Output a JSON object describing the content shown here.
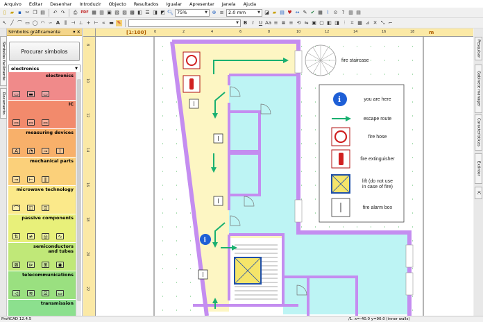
{
  "menu": [
    "Arquivo",
    "Editar",
    "Desenhar",
    "Introduzir",
    "Objecto",
    "Resultados",
    "Igualar",
    "Apresentar",
    "Janela",
    "Ajuda"
  ],
  "toolbar": {
    "zoom": "75%",
    "line_width": "2.0 mm",
    "pdf_label": "PDF"
  },
  "panel": {
    "title": "Símbolos gráficamente",
    "search_button": "Procurar símbolos",
    "library": "electronics",
    "categories": [
      {
        "name": "electronics",
        "color": "#f08a8a",
        "icons": [
          "▭",
          "▬",
          "▭"
        ]
      },
      {
        "name": "IC",
        "color": "#f28a6c",
        "icons": [
          "▭",
          "▭",
          "▭"
        ]
      },
      {
        "name": "measuring devices",
        "color": "#f8b06a",
        "icons": [
          "A",
          "◔",
          "⊸",
          "⌇"
        ]
      },
      {
        "name": "mechanical parts",
        "color": "#fbd07a",
        "icons": [
          "⊸",
          "⊢",
          "‖"
        ]
      },
      {
        "name": "microwave technology",
        "color": "#fbe98a",
        "icons": [
          "⌒",
          "◫",
          "⊡"
        ]
      },
      {
        "name": "passive components",
        "color": "#e8f07a",
        "icons": [
          "⇅",
          "≠",
          "◎",
          "∿"
        ]
      },
      {
        "name": "semiconductors and tubes",
        "color": "#c0e878",
        "icons": [
          "⊠",
          "⊳",
          "⊞",
          "◉"
        ]
      },
      {
        "name": "telecommunications",
        "color": "#9ae080",
        "icons": [
          "◁",
          "≋",
          "⊡",
          "▭"
        ]
      },
      {
        "name": "transmission",
        "color": "#8ce08e",
        "icons": []
      }
    ]
  },
  "left_tabs": [
    "Símbolos facilmente",
    "Documento"
  ],
  "right_tabs": [
    "Pesquisar",
    "Gabinete manager",
    "Características",
    "Extintor",
    "IC"
  ],
  "ruler": {
    "scale_label": "[1:100]",
    "unit": "m",
    "h_ticks": [
      "0",
      "2",
      "4",
      "6",
      "8",
      "10",
      "12",
      "14",
      "16",
      "18"
    ],
    "v_ticks": [
      "8",
      "10",
      "12",
      "14",
      "16",
      "18",
      "20",
      "22"
    ]
  },
  "plan": {
    "fire_staircase": "fire staircase",
    "legend": [
      {
        "symbol": "info",
        "label": "you are here"
      },
      {
        "symbol": "arrow",
        "label": "escape route"
      },
      {
        "symbol": "hose",
        "label": "fire hose"
      },
      {
        "symbol": "extinguisher",
        "label": "fire extinguisher"
      },
      {
        "symbol": "lift",
        "label": "lift (do not use in case of fire)"
      },
      {
        "symbol": "alarm",
        "label": "fire alarm box"
      }
    ]
  },
  "colors": {
    "wall": "#c48df0",
    "corridor": "#fdf6c3",
    "room": "#bdf4f4",
    "arrow": "#19b070",
    "info": "#1e5fd6"
  },
  "status": {
    "app": "ProfiCAD 12.4.5",
    "coords": "/1. x=-40.0  y=90.0 (inner walls)"
  }
}
